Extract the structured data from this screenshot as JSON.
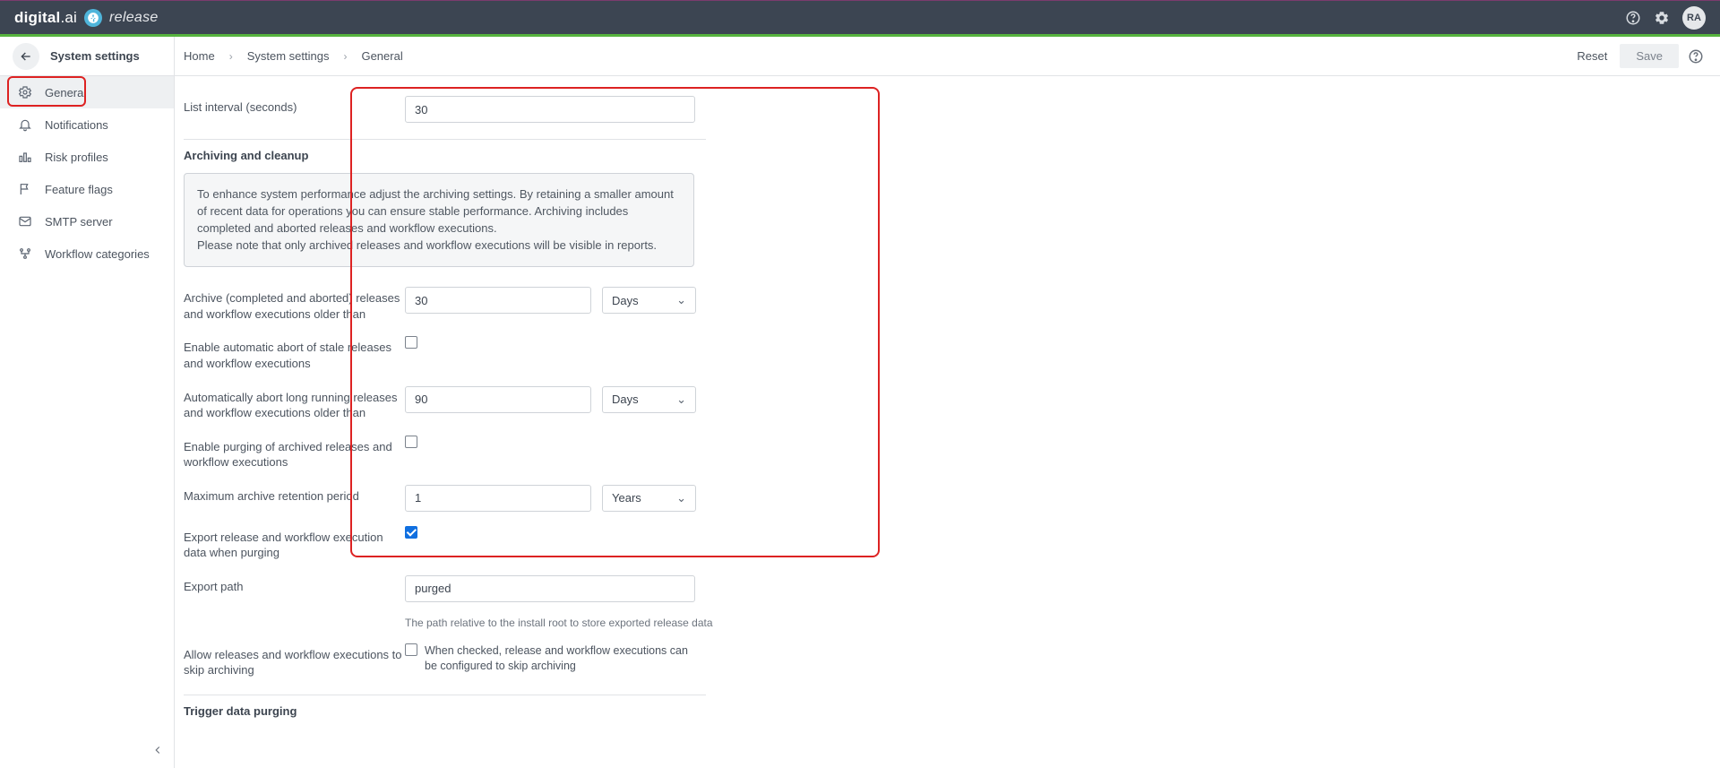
{
  "topbar": {
    "brand_bold": "digital",
    "brand_suffix": ".ai",
    "product": "release",
    "avatar": "RA"
  },
  "sidebar": {
    "title": "System settings",
    "items": [
      {
        "label": "General"
      },
      {
        "label": "Notifications"
      },
      {
        "label": "Risk profiles"
      },
      {
        "label": "Feature flags"
      },
      {
        "label": "SMTP server"
      },
      {
        "label": "Workflow categories"
      }
    ]
  },
  "header": {
    "breadcrumbs": [
      "Home",
      "System settings",
      "General"
    ],
    "reset": "Reset",
    "save": "Save"
  },
  "form": {
    "list_interval_label": "List interval (seconds)",
    "list_interval_value": "30",
    "archiving_title": "Archiving and cleanup",
    "archiving_info_l1": "To enhance system performance adjust the archiving settings. By retaining a smaller amount of recent data for operations you can ensure stable performance. Archiving includes completed and aborted releases and workflow executions.",
    "archiving_info_l2": "Please note that only archived releases and workflow executions will be visible in reports.",
    "archive_older_label": "Archive (completed and aborted) releases and workflow executions older than",
    "archive_older_value": "30",
    "archive_older_unit": "Days",
    "enable_auto_abort_label": "Enable automatic abort of stale releases and workflow executions",
    "enable_auto_abort_checked": false,
    "auto_abort_label": "Automatically abort long running releases and workflow executions older than",
    "auto_abort_value": "90",
    "auto_abort_unit": "Days",
    "enable_purge_label": "Enable purging of archived releases and workflow executions",
    "enable_purge_checked": false,
    "max_retention_label": "Maximum archive retention period",
    "max_retention_value": "1",
    "max_retention_unit": "Years",
    "export_when_purge_label": "Export release and workflow execution data when purging",
    "export_when_purge_checked": true,
    "export_path_label": "Export path",
    "export_path_value": "purged",
    "export_path_help": "The path relative to the install root to store exported release data",
    "allow_skip_label": "Allow releases and workflow executions to skip archiving",
    "allow_skip_checked": false,
    "allow_skip_help": "When checked, release and workflow executions can be configured to skip archiving",
    "trigger_title": "Trigger data purging"
  }
}
